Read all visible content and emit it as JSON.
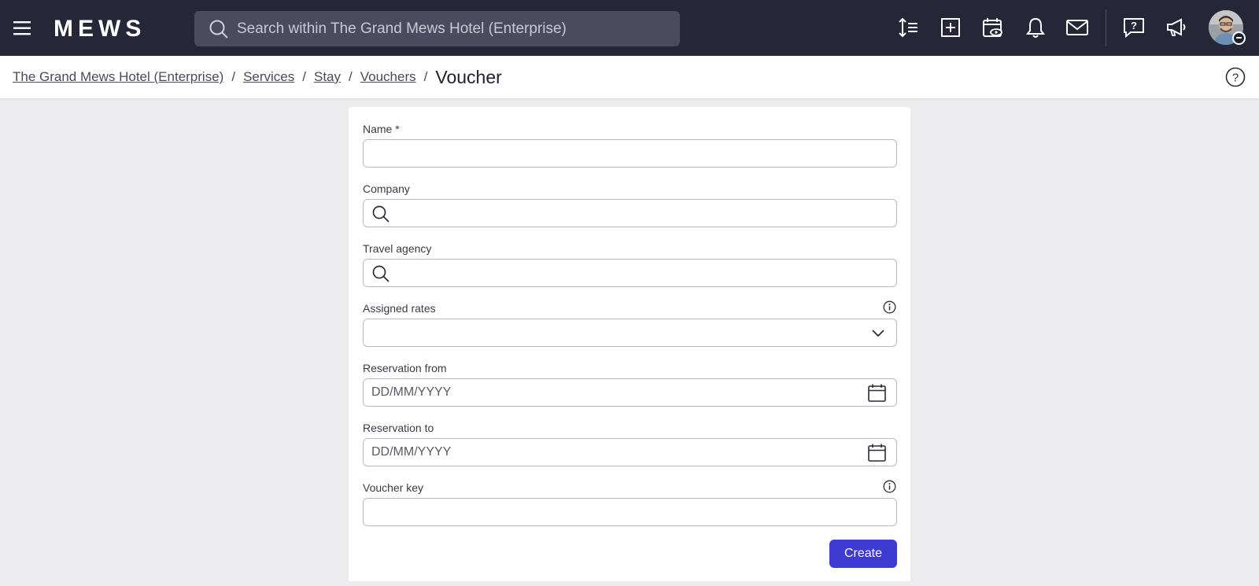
{
  "topbar": {
    "logo_text": "MEWS",
    "search": {
      "placeholder": "Search within The Grand Mews Hotel (Enterprise)",
      "value": ""
    },
    "icons": [
      "sort-lines-icon",
      "add-square-icon",
      "calendar-eye-icon",
      "bell-icon",
      "mail-icon",
      "help-chat-icon",
      "megaphone-icon"
    ]
  },
  "breadcrumb": {
    "items": [
      "The Grand Mews Hotel (Enterprise)",
      "Services",
      "Stay",
      "Vouchers"
    ],
    "separator": "/",
    "current": "Voucher"
  },
  "form": {
    "name": {
      "label": "Name *",
      "value": ""
    },
    "company": {
      "label": "Company",
      "value": ""
    },
    "travel_agency": {
      "label": "Travel agency",
      "value": ""
    },
    "assigned_rates": {
      "label": "Assigned rates",
      "value": ""
    },
    "reservation_from": {
      "label": "Reservation from",
      "placeholder": "DD/MM/YYYY",
      "value": ""
    },
    "reservation_to": {
      "label": "Reservation to",
      "placeholder": "DD/MM/YYYY",
      "value": ""
    },
    "voucher_key": {
      "label": "Voucher key",
      "value": ""
    },
    "create_label": "Create"
  },
  "colors": {
    "topbar_bg": "#252638",
    "search_bg": "#4a4b5e",
    "page_bg": "#ececef",
    "primary": "#3d3bd1"
  }
}
